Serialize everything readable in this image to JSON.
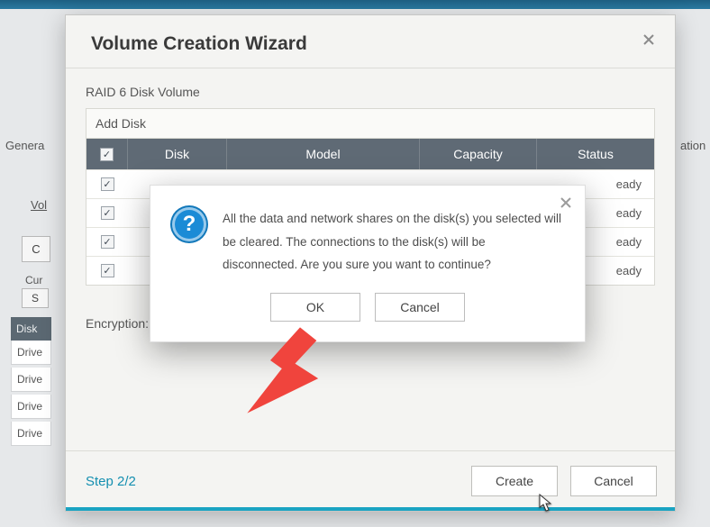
{
  "bg": {
    "genera": "Genera",
    "ation": "ation",
    "vol": "Vol",
    "c": "C",
    "curr": "Cur",
    "s": "S",
    "disk_header": "Disk",
    "rows": [
      "Drive",
      "Drive",
      "Drive",
      "Drive"
    ]
  },
  "wizard": {
    "title": "Volume Creation Wizard",
    "subtitle": "RAID 6 Disk Volume",
    "add_disk": "Add Disk",
    "columns": {
      "disk": "Disk",
      "model": "Model",
      "capacity": "Capacity",
      "status": "Status"
    },
    "rows": [
      {
        "status": "eady"
      },
      {
        "status": "eady"
      },
      {
        "status": "eady"
      },
      {
        "status": "eady"
      }
    ],
    "encryption_label": "Encryption:",
    "step": "Step 2/2",
    "create": "Create",
    "cancel": "Cancel"
  },
  "modal": {
    "message": "All the data and network shares on the disk(s) you selected will be cleared. The connections to the disk(s) will be disconnected. Are you sure you want to continue?",
    "ok": "OK",
    "cancel": "Cancel"
  },
  "colors": {
    "accent": "#1aa3c2",
    "arrow": "#f0443d"
  }
}
